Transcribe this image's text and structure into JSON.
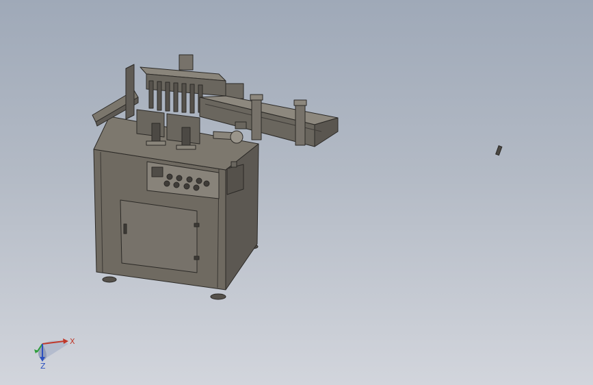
{
  "viewport": {
    "background_top": "#9fa9b8",
    "background_bottom": "#d2d5dc"
  },
  "model": {
    "body_color": "#6f6a61",
    "edge_color": "#2b2926",
    "panel_color": "#7a756b"
  },
  "triad": {
    "x_label": "X",
    "z_label": "Z",
    "x_color": "#c0392b",
    "y_color": "#2e9e3b",
    "z_color": "#2b4fbf"
  }
}
